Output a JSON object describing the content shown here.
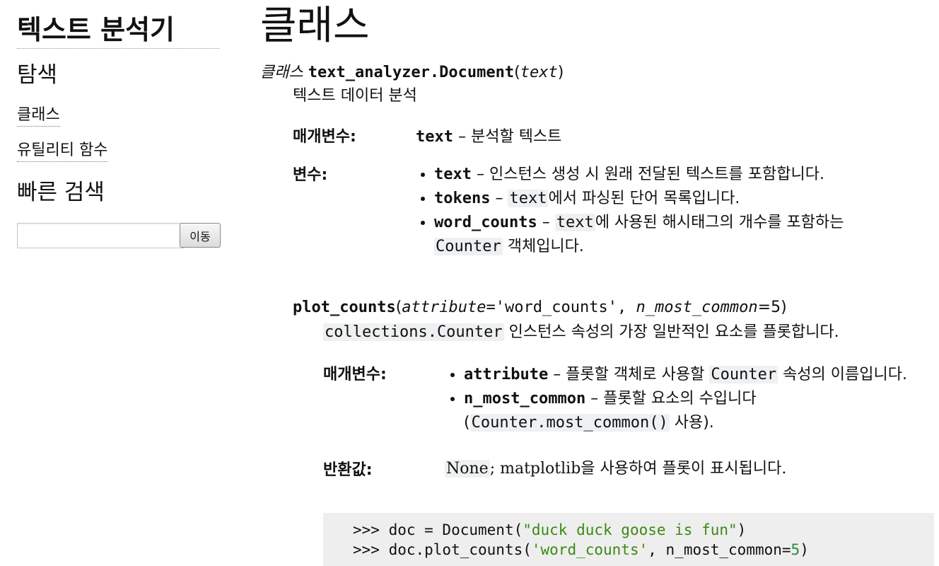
{
  "sidebar": {
    "project_title": "텍스트 분석기",
    "nav_heading": "탐색",
    "nav_links": [
      "클래스",
      "유틸리티 함수"
    ],
    "search_heading": "빠른 검색",
    "search_value": "",
    "search_button": "이동"
  },
  "page": {
    "title": "클래스",
    "class_keyword": "클래스",
    "class_name": "text_analyzer.Document",
    "open_paren": "(",
    "class_param": "text",
    "close_paren": ")",
    "class_description": "텍스트 데이터 분석"
  },
  "class_params": {
    "label": "매개변수:",
    "name": "text",
    "desc": "– 분석할 텍스트"
  },
  "class_vars": {
    "label": "변수:",
    "items": [
      {
        "name": "text",
        "pre": " – 인스턴스 생성 시 원래 전달된 텍스트를 포함합니다.",
        "code": "",
        "post": "",
        "code2": "",
        "post2": ""
      },
      {
        "name": "tokens",
        "pre": " – ",
        "code": "text",
        "post": "에서 파싱된 단어 목록입니다.",
        "code2": "",
        "post2": ""
      },
      {
        "name": "word_counts",
        "pre": " – ",
        "code": "text",
        "post": "에 사용된 해시태그의 개수를 포함하는 ",
        "code2": "Counter",
        "post2": " 객체입니다."
      }
    ]
  },
  "method": {
    "name": "plot_counts",
    "open_paren": "(",
    "param1": "attribute",
    "param1_default": "='word_counts'",
    "sep": ", ",
    "param2": "n_most_common",
    "param2_default": "=5",
    "close_paren": ")",
    "desc_code": "collections.Counter",
    "desc_text": " 인스턴스 속성의 가장 일반적인 요소를 플롯합니다.",
    "params_label": "매개변수:",
    "params": [
      {
        "name": "attribute",
        "pre": " – 플롯할 객체로 사용할 ",
        "code": "Counter",
        "post": " 속성의 이름입니다."
      },
      {
        "name": "n_most_common",
        "pre": "  – 플롯할 요소의 수입니다 (",
        "code": "Counter.most_common()",
        "post": " 사용)."
      }
    ],
    "returns_label": "반환값:",
    "returns_code": "None",
    "returns_text": "; matplotlib을 사용하여 플롯이 표시됩니다."
  },
  "example": {
    "line1_prompt": ">>> ",
    "line1_a": "doc = Document(",
    "line1_str": "\"duck duck goose is fun\"",
    "line1_b": ")",
    "line2_prompt": ">>> ",
    "line2_a": "doc.plot_counts(",
    "line2_str": "'word_counts'",
    "line2_b": ", n_most_common=",
    "line2_num": "5",
    "line2_c": ")"
  }
}
